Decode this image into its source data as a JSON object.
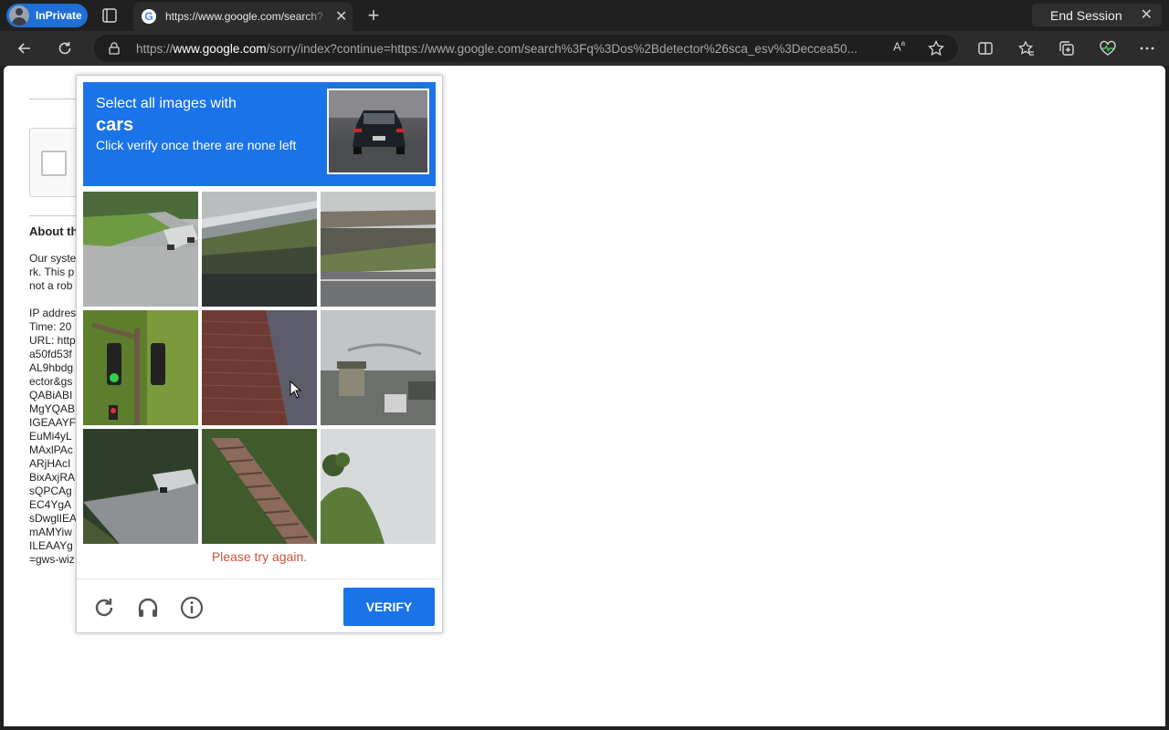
{
  "browser": {
    "inprivate_label": "InPrivate",
    "tab_title": "https://www.google.com/search?q=os+detector",
    "tab_title_visible": "https://www.google.com/search?",
    "end_session_label": "End Session",
    "url_prefix": "https://",
    "url_domain": "www.google.com",
    "url_rest": "/sorry/index?continue=https://www.google.com/search%3Fq%3Dos%2Bdetector%26sca_esv%3Deccea50..."
  },
  "page": {
    "section_heading": "About th",
    "body_lines": "Our syste\nrk. This p\nnot a rob\n\nIP addres\nTime: 20\nURL: http\na50fd53f\nAL9hbdg\nector&gs\nQABiABI\nMgYQAB\nIGEAAYF\nEuMi4yL\nMAxlPAc\nARjHAcI\nBixAxjRA\nsQPCAg\nEC4YgA\nsDwglIEA\nmAMYiw\nILEAAYg\n=gws-wiz"
  },
  "captcha": {
    "instruction_line1": "Select all images with",
    "target_object": "cars",
    "instruction_line3": "Click verify once there are none left",
    "error_message": "Please try again.",
    "verify_label": "VERIFY",
    "tiles": [
      {
        "name": "tile-street-corner-car"
      },
      {
        "name": "tile-overpass-bridge"
      },
      {
        "name": "tile-highway-underpass"
      },
      {
        "name": "tile-traffic-light"
      },
      {
        "name": "tile-brick-wall"
      },
      {
        "name": "tile-road-with-truck"
      },
      {
        "name": "tile-street-with-car"
      },
      {
        "name": "tile-outdoor-stairs"
      },
      {
        "name": "tile-palm-trees"
      }
    ]
  },
  "colors": {
    "accent": "#1a73e8",
    "error": "#c9543d"
  }
}
